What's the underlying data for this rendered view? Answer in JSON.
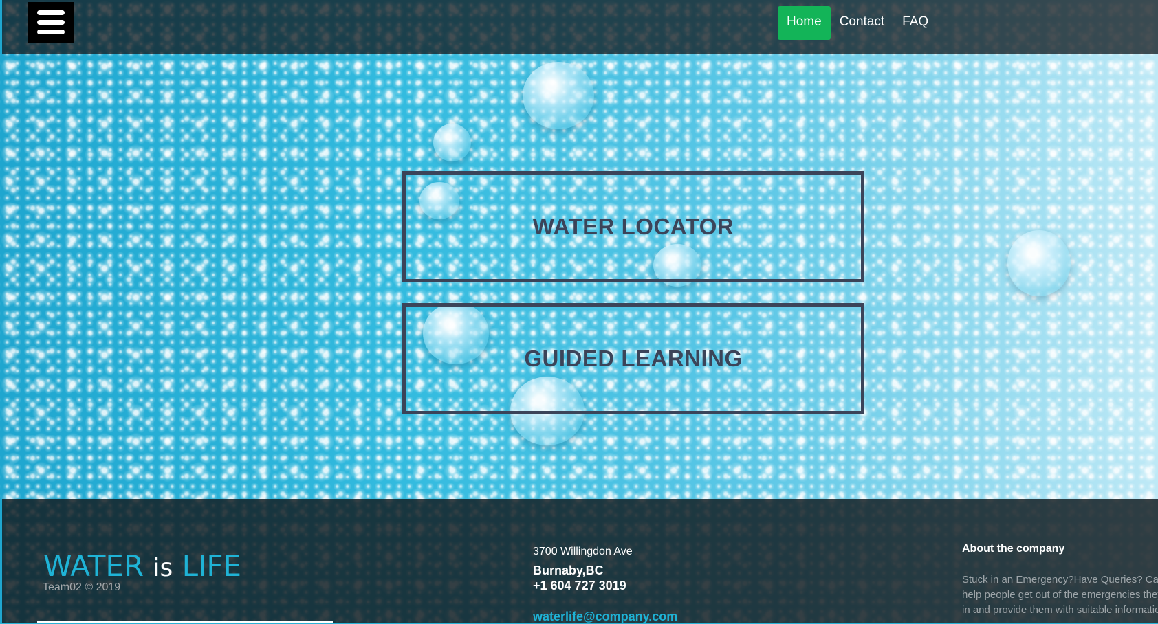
{
  "header": {
    "nav": [
      {
        "label": "Home",
        "active": true
      },
      {
        "label": "Contact",
        "active": false
      },
      {
        "label": "FAQ",
        "active": false
      }
    ]
  },
  "hero": {
    "water_locator_label": "WATER LOCATOR",
    "guided_learning_label": "GUIDED LEARNING"
  },
  "footer": {
    "brand_part1": "WATER",
    "brand_part2": "is",
    "brand_part3": "LIFE",
    "copyright": "Team02 © 2019",
    "address": "3700 Willingdon Ave",
    "city": "Burnaby,BC",
    "phone": "+1 604 727 3019",
    "email": "waterlife@company.com",
    "about_title": "About the company",
    "about_lines": [
      "Stuck in an Emergency?Have Queries? Call",
      "help people get out of the emergencies they",
      "in and provide them with suitable information"
    ]
  },
  "colors": {
    "accent": "#1fb3d6",
    "nav_active": "#13b458",
    "hero_border": "#3b4459"
  }
}
